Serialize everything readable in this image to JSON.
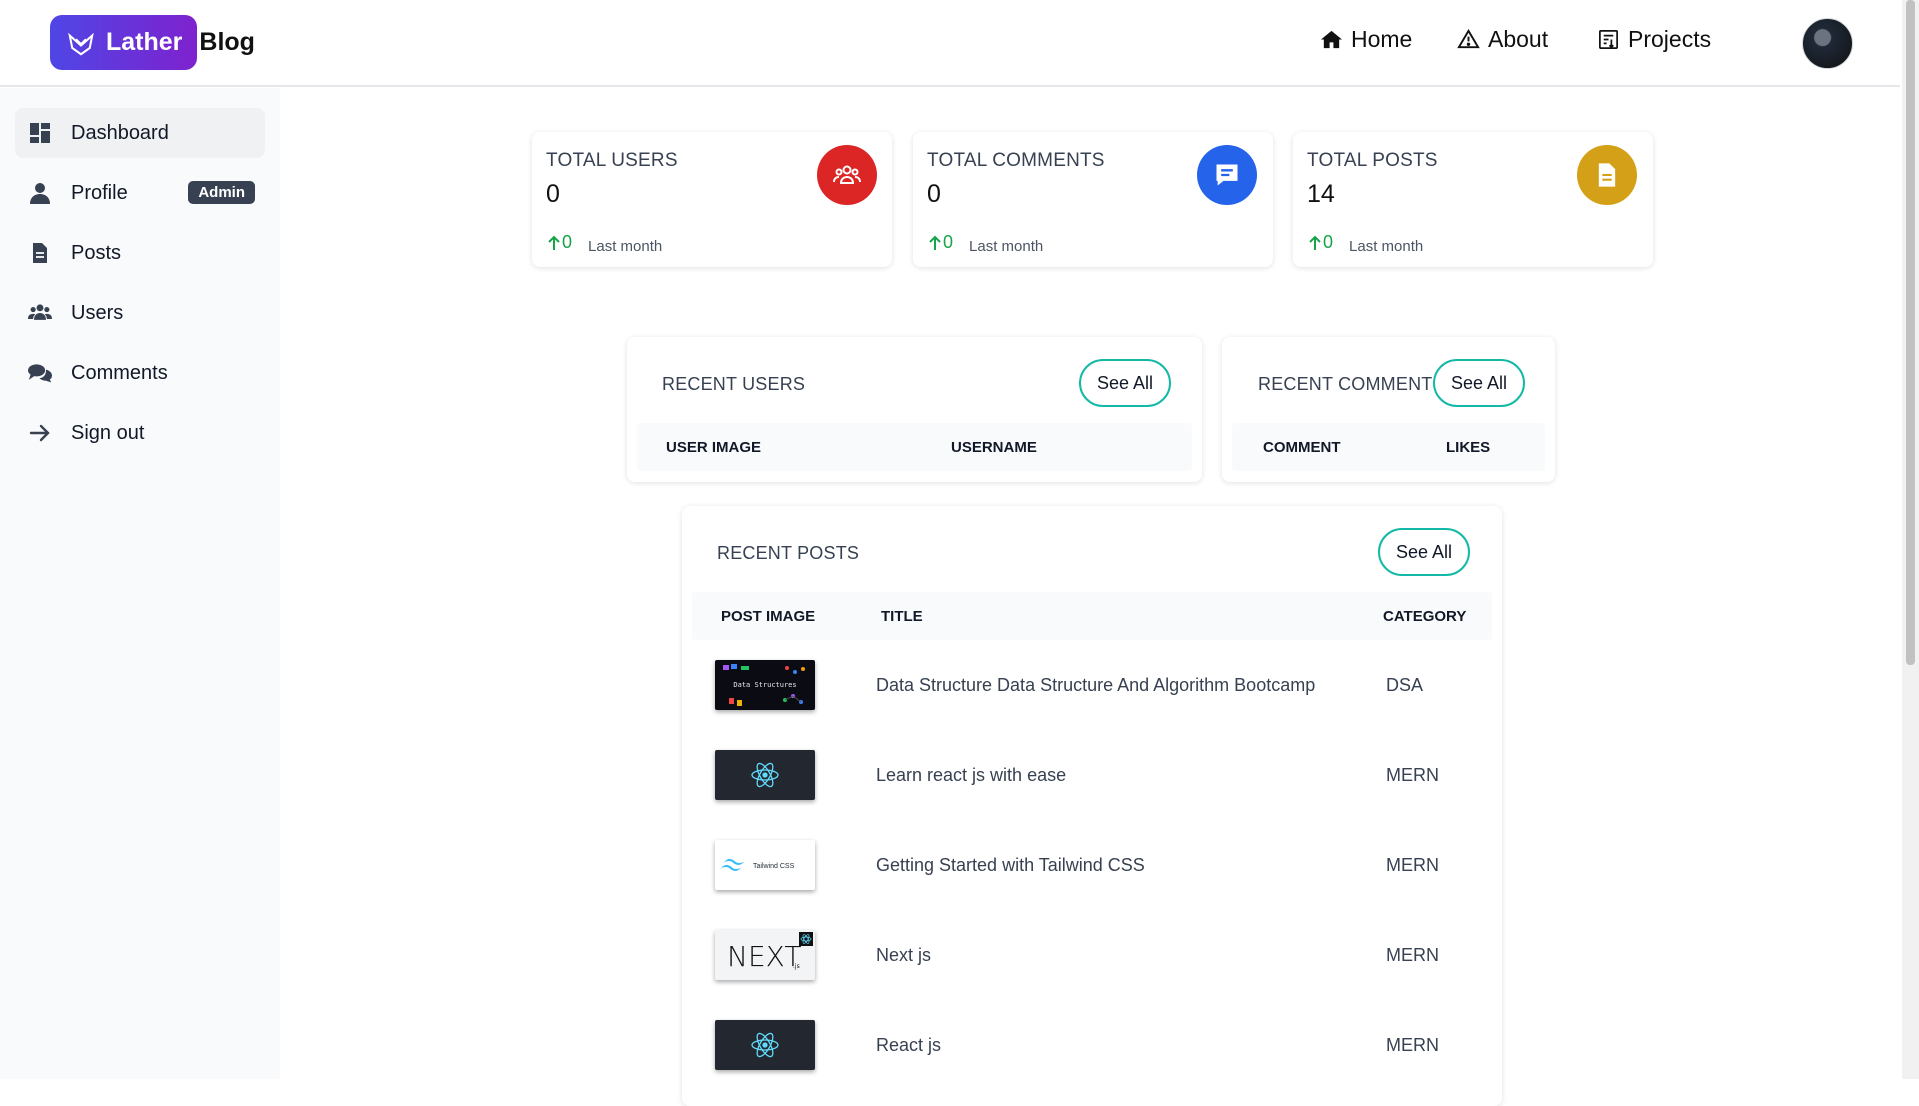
{
  "brand": {
    "name": "Lather",
    "suffix": "Blog"
  },
  "nav": [
    {
      "label": "Home",
      "icon": "home-icon"
    },
    {
      "label": "About",
      "icon": "warning-triangle-icon"
    },
    {
      "label": "Projects",
      "icon": "projects-icon"
    }
  ],
  "sidebar": {
    "items": [
      {
        "label": "Dashboard",
        "icon": "dashboard-icon",
        "active": true
      },
      {
        "label": "Profile",
        "icon": "user-icon",
        "badge": "Admin"
      },
      {
        "label": "Posts",
        "icon": "document-icon"
      },
      {
        "label": "Users",
        "icon": "users-icon"
      },
      {
        "label": "Comments",
        "icon": "comments-icon"
      },
      {
        "label": "Sign out",
        "icon": "arrow-right-icon"
      }
    ]
  },
  "stats": [
    {
      "title": "TOTAL USERS",
      "value": "0",
      "change": "0",
      "period": "Last month",
      "color": "#dc2626",
      "icon": "users-group-icon"
    },
    {
      "title": "TOTAL COMMENTS",
      "value": "0",
      "change": "0",
      "period": "Last month",
      "color": "#2563eb",
      "icon": "comment-icon"
    },
    {
      "title": "TOTAL POSTS",
      "value": "14",
      "change": "0",
      "period": "Last month",
      "color": "#d4a017",
      "icon": "document-icon"
    }
  ],
  "recent_users": {
    "title": "RECENT USERS",
    "see_all": "See All",
    "columns": [
      "USER IMAGE",
      "USERNAME"
    ]
  },
  "recent_comments": {
    "title": "RECENT COMMENTS",
    "see_all": "See All",
    "columns": [
      "COMMENT",
      "LIKES"
    ]
  },
  "recent_posts": {
    "title": "RECENT POSTS",
    "see_all": "See All",
    "columns": [
      "POST IMAGE",
      "TITLE",
      "CATEGORY"
    ],
    "rows": [
      {
        "title": "Data Structure Data Structure And Algorithm Bootcamp",
        "category": "DSA",
        "thumb": "data-structures",
        "thumb_text": "Data Structures"
      },
      {
        "title": "Learn react js with ease",
        "category": "MERN",
        "thumb": "react"
      },
      {
        "title": "Getting Started with Tailwind CSS",
        "category": "MERN",
        "thumb": "tailwind",
        "thumb_text": "Tailwind CSS"
      },
      {
        "title": "Next js",
        "category": "MERN",
        "thumb": "next",
        "thumb_text": "NEXT",
        "thumb_sub": ".js"
      },
      {
        "title": "React js",
        "category": "MERN",
        "thumb": "react"
      }
    ]
  },
  "colors": {
    "accent": "#14b8a6",
    "brand_start": "#4f46e5",
    "brand_end": "#7e22ce",
    "up": "#16a34a"
  }
}
